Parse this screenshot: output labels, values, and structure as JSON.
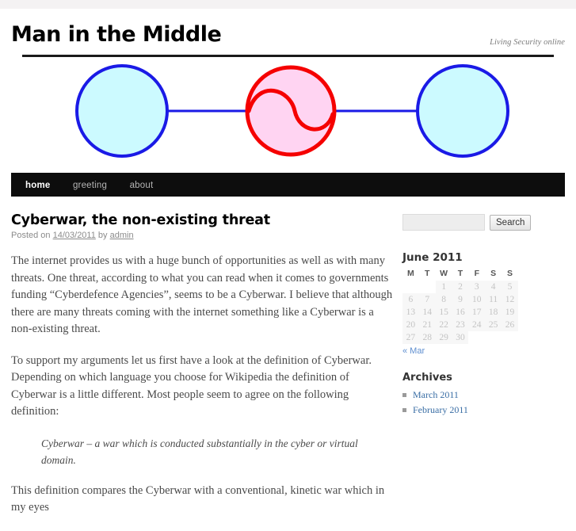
{
  "site": {
    "title": "Man in the Middle",
    "description": "Living Security online"
  },
  "nav": {
    "items": [
      {
        "label": "home",
        "current": true
      },
      {
        "label": "greeting",
        "current": false
      },
      {
        "label": "about",
        "current": false
      }
    ]
  },
  "banner": {
    "alt": "man-in-the-middle diagram",
    "colors": {
      "node_fill": "#ccfaff",
      "node_stroke": "#1a1ae6",
      "mitm_fill": "#ffd4f2",
      "mitm_stroke": "#f50000",
      "link": "#1a1ae6"
    }
  },
  "post": {
    "title": "Cyberwar, the non-existing threat",
    "meta_prefix": "Posted on",
    "date": "14/03/2011",
    "meta_by": "by",
    "author": "admin",
    "paragraphs": [
      "The internet provides us with a huge bunch of opportunities as well as with many threats. One threat, according to what you can read when it comes to governments funding “Cyberdefence Agencies”, seems to be a Cyberwar. I believe that although there are many threats coming with the internet something like a Cyberwar is a non-existing threat.",
      "To support my arguments let us first have a look at the definition of Cyberwar. Depending on which language you choose for Wikipedia the definition of Cyberwar is a little different. Most people seem to agree on the following definition:"
    ],
    "quote": "Cyberwar – a war which is conducted substantially in the cyber or virtual domain.",
    "paragraph_after_quote": "This definition compares the Cyberwar with a conventional, kinetic war which in my eyes"
  },
  "search": {
    "value": "",
    "placeholder": "",
    "button_label": "Search"
  },
  "calendar": {
    "caption": "June 2011",
    "weekdays": [
      "M",
      "T",
      "W",
      "T",
      "F",
      "S",
      "S"
    ],
    "weeks": [
      [
        "",
        "",
        "1",
        "2",
        "3",
        "4",
        "5"
      ],
      [
        "6",
        "7",
        "8",
        "9",
        "10",
        "11",
        "12"
      ],
      [
        "13",
        "14",
        "15",
        "16",
        "17",
        "18",
        "19"
      ],
      [
        "20",
        "21",
        "22",
        "23",
        "24",
        "25",
        "26"
      ],
      [
        "27",
        "28",
        "29",
        "30",
        "",
        "",
        ""
      ]
    ],
    "prev_label": "« Mar"
  },
  "archives": {
    "title": "Archives",
    "items": [
      {
        "label": "March 2011"
      },
      {
        "label": "February 2011"
      }
    ]
  }
}
